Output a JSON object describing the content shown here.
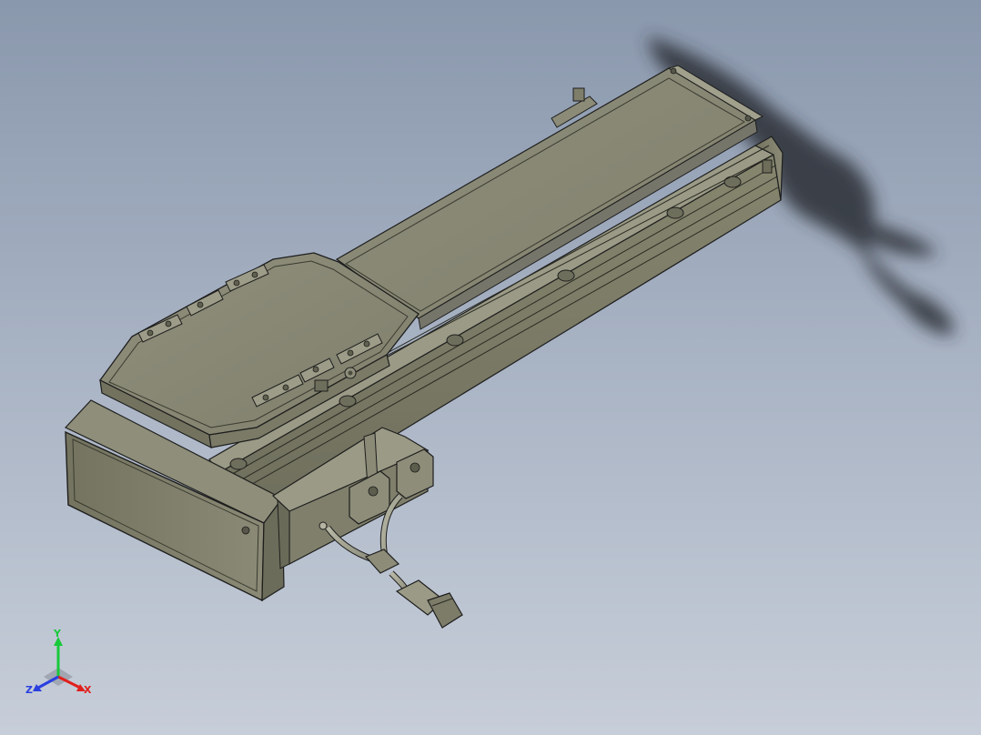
{
  "viewport": {
    "background_top": "#8a98ad",
    "background_bottom": "#c7ced9"
  },
  "model": {
    "body_color": "#8c8c79",
    "edge_color": "#1e1e1e",
    "shadow_color": "#2b2f36"
  },
  "triad": {
    "x_label": "X",
    "y_label": "Y",
    "z_label": "Z",
    "x_color": "#e0201c",
    "y_color": "#18c93a",
    "z_color": "#2a3fe0"
  }
}
